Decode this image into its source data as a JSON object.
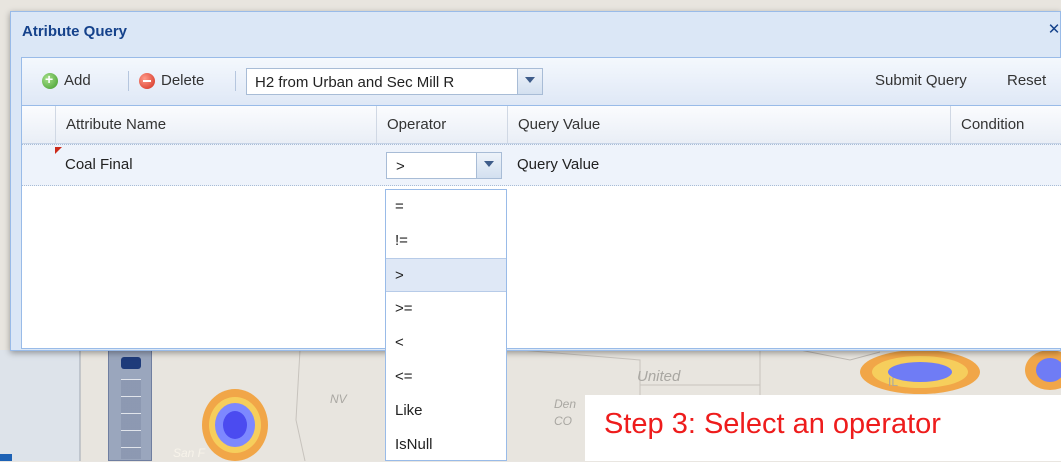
{
  "dialog": {
    "title": "Atribute Query",
    "close_icon": "close-icon"
  },
  "toolbar": {
    "add_label": "Add",
    "delete_label": "Delete",
    "query_select_value": "H2 from Urban and Sec Mill R",
    "submit_label": "Submit Query",
    "reset_label": "Reset"
  },
  "grid": {
    "columns": [
      "Attribute Name",
      "Operator",
      "Query Value",
      "Condition"
    ],
    "rows": [
      {
        "attribute": "Coal Final",
        "operator": ">",
        "query_value": "Query Value",
        "condition": ""
      }
    ]
  },
  "operator_dropdown": {
    "options": [
      "=",
      "!=",
      ">",
      ">=",
      "<",
      "<=",
      "Like",
      "IsNull"
    ],
    "selected": ">"
  },
  "map": {
    "labels": [
      "NV",
      "United",
      "Den",
      "CO",
      "San F",
      "IL"
    ]
  },
  "caption": {
    "text": "Step 3: Select an operator"
  },
  "colors": {
    "title": "#15428b",
    "caption": "#ee1c1c",
    "header_bg": "#dbe7f6",
    "selection": "#dfe8f6"
  }
}
